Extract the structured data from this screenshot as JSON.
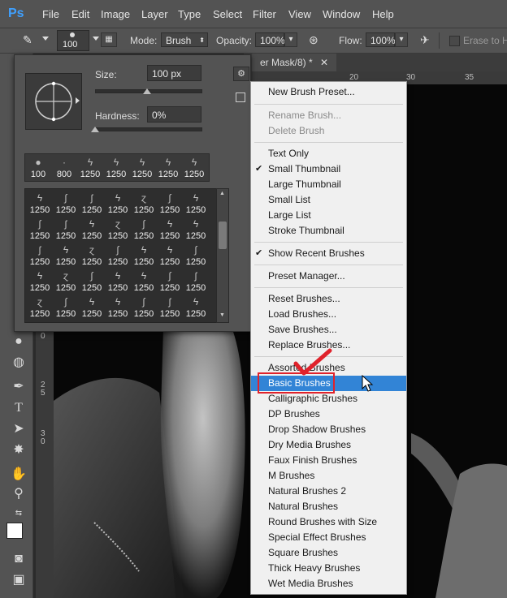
{
  "app": {
    "logo": "Ps"
  },
  "menubar": [
    "File",
    "Edit",
    "Image",
    "Layer",
    "Type",
    "Select",
    "Filter",
    "View",
    "Window",
    "Help"
  ],
  "options_bar": {
    "brush_size": "100",
    "mode_label": "Mode:",
    "mode_value": "Brush",
    "opacity_label": "Opacity:",
    "opacity_value": "100%",
    "flow_label": "Flow:",
    "flow_value": "100%",
    "erase_label": "Erase to Hi"
  },
  "document": {
    "tab_title": "er Mask/8) *",
    "ruler_top": [
      "20",
      "25",
      "30",
      "35"
    ],
    "ruler_left": [
      "0",
      "2",
      "5",
      "3",
      "0"
    ]
  },
  "brush_panel": {
    "size_label": "Size:",
    "size_value": "100 px",
    "hardness_label": "Hardness:",
    "hardness_value": "0%",
    "recent": [
      "100",
      "800",
      "1250",
      "1250",
      "1250",
      "1250",
      "1250"
    ],
    "grid_rows": [
      [
        "1250",
        "1250",
        "1250",
        "1250",
        "1250",
        "1250",
        "1250"
      ],
      [
        "1250",
        "1250",
        "1250",
        "1250",
        "1250",
        "1250",
        "1250"
      ],
      [
        "1250",
        "1250",
        "1250",
        "1250",
        "1250",
        "1250",
        "1250"
      ],
      [
        "1250",
        "1250",
        "1250",
        "1250",
        "1250",
        "1250",
        "1250"
      ],
      [
        "1250",
        "1250",
        "1250",
        "1250",
        "1250",
        "1250",
        "1250"
      ]
    ]
  },
  "menu": {
    "items": [
      {
        "label": "New Brush Preset...",
        "disabled": false,
        "checked": false
      },
      {
        "label": "Rename Brush...",
        "disabled": true,
        "checked": false
      },
      {
        "label": "Delete Brush",
        "disabled": true,
        "checked": false
      },
      {
        "label": "Text Only",
        "disabled": false,
        "checked": false
      },
      {
        "label": "Small Thumbnail",
        "disabled": false,
        "checked": true
      },
      {
        "label": "Large Thumbnail",
        "disabled": false,
        "checked": false
      },
      {
        "label": "Small List",
        "disabled": false,
        "checked": false
      },
      {
        "label": "Large List",
        "disabled": false,
        "checked": false
      },
      {
        "label": "Stroke Thumbnail",
        "disabled": false,
        "checked": false
      },
      {
        "label": "Show Recent Brushes",
        "disabled": false,
        "checked": true
      },
      {
        "label": "Preset Manager...",
        "disabled": false,
        "checked": false
      },
      {
        "label": "Reset Brushes...",
        "disabled": false,
        "checked": false
      },
      {
        "label": "Load Brushes...",
        "disabled": false,
        "checked": false
      },
      {
        "label": "Save Brushes...",
        "disabled": false,
        "checked": false
      },
      {
        "label": "Replace Brushes...",
        "disabled": false,
        "checked": false
      },
      {
        "label": "Assorted Brushes",
        "disabled": false,
        "checked": false
      },
      {
        "label": "Basic Brushes",
        "disabled": false,
        "checked": false,
        "selected": true
      },
      {
        "label": "Calligraphic Brushes",
        "disabled": false,
        "checked": false
      },
      {
        "label": "DP Brushes",
        "disabled": false,
        "checked": false
      },
      {
        "label": "Drop Shadow Brushes",
        "disabled": false,
        "checked": false
      },
      {
        "label": "Dry Media Brushes",
        "disabled": false,
        "checked": false
      },
      {
        "label": "Faux Finish Brushes",
        "disabled": false,
        "checked": false
      },
      {
        "label": "M Brushes",
        "disabled": false,
        "checked": false
      },
      {
        "label": "Natural Brushes 2",
        "disabled": false,
        "checked": false
      },
      {
        "label": "Natural Brushes",
        "disabled": false,
        "checked": false
      },
      {
        "label": "Round Brushes with Size",
        "disabled": false,
        "checked": false
      },
      {
        "label": "Special Effect Brushes",
        "disabled": false,
        "checked": false
      },
      {
        "label": "Square Brushes",
        "disabled": false,
        "checked": false
      },
      {
        "label": "Thick Heavy Brushes",
        "disabled": false,
        "checked": false
      },
      {
        "label": "Wet Media Brushes",
        "disabled": false,
        "checked": false
      }
    ]
  },
  "colors": {
    "selection": "#3284d6",
    "highlight": "#e0222b",
    "ps_blue": "#3fa0ff"
  },
  "icons": [
    "eraser-icon",
    "brush-tip-icon",
    "brush-panel-icon",
    "airbrush-icon",
    "gear-icon",
    "tool-icons",
    "mouse-cursor-icon",
    "red-checkmark-icon"
  ]
}
